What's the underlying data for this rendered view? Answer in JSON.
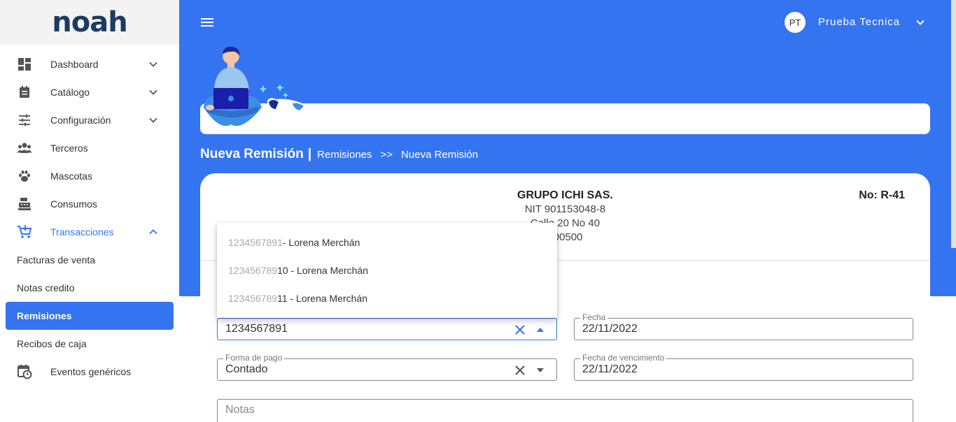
{
  "logo": "noah",
  "sidebar": {
    "items": [
      {
        "label": "Dashboard",
        "icon": "dashboard-icon",
        "has_chevron": true
      },
      {
        "label": "Catálogo",
        "icon": "catalog-icon",
        "has_chevron": true
      },
      {
        "label": "Configuración",
        "icon": "sliders-icon",
        "has_chevron": true
      },
      {
        "label": "Terceros",
        "icon": "people-icon",
        "has_chevron": false
      },
      {
        "label": "Mascotas",
        "icon": "paw-icon",
        "has_chevron": false
      },
      {
        "label": "Consumos",
        "icon": "cash-register-icon",
        "has_chevron": false
      },
      {
        "label": "Transacciones",
        "icon": "cart-icon",
        "has_chevron": true,
        "expanded": true
      }
    ],
    "sub_items": [
      "Facturas de venta",
      "Notas credito",
      "Remisiones",
      "Recibos de caja"
    ],
    "selected_sub_item": "Remisiones",
    "last_item": {
      "label": "Eventos genéricos",
      "icon": "calendar-clock-icon"
    }
  },
  "header": {
    "avatar_initials": "PT",
    "username": "Prueba Tecnica"
  },
  "breadcrumb": {
    "title": "Nueva Remisión",
    "separator": "|",
    "link": "Remisiones",
    "arrow": ">>",
    "current": "Nueva Remisión"
  },
  "company": {
    "name": "GRUPO ICHI SAS.",
    "nit": "NIT 901153048-8",
    "address": "Calle 20 No 40",
    "phone": "400500"
  },
  "document_number": "No: R-41",
  "form": {
    "client_value": "1234567891",
    "fecha_label": "Fecha",
    "fecha_value": "22/11/2022",
    "forma_pago_label": "Forma de pago",
    "forma_pago_value": "Contado",
    "fecha_vencimiento_label": "Fecha de vencimiento",
    "fecha_vencimiento_value": "22/11/2022",
    "notas_placeholder": "Notas"
  },
  "dropdown": {
    "options": [
      {
        "match": "1234567891",
        "rest": " - Lorena Merchán"
      },
      {
        "match": "123456789",
        "rest": "10 - Lorena Merchán"
      },
      {
        "match": "123456789",
        "rest": "11 - Lorena Merchán"
      }
    ]
  },
  "colors": {
    "primary": "#3574f0",
    "logo": "#1e3a5f",
    "sidebar_bg": "#ffffff",
    "logo_bg": "#f3f3f3"
  }
}
